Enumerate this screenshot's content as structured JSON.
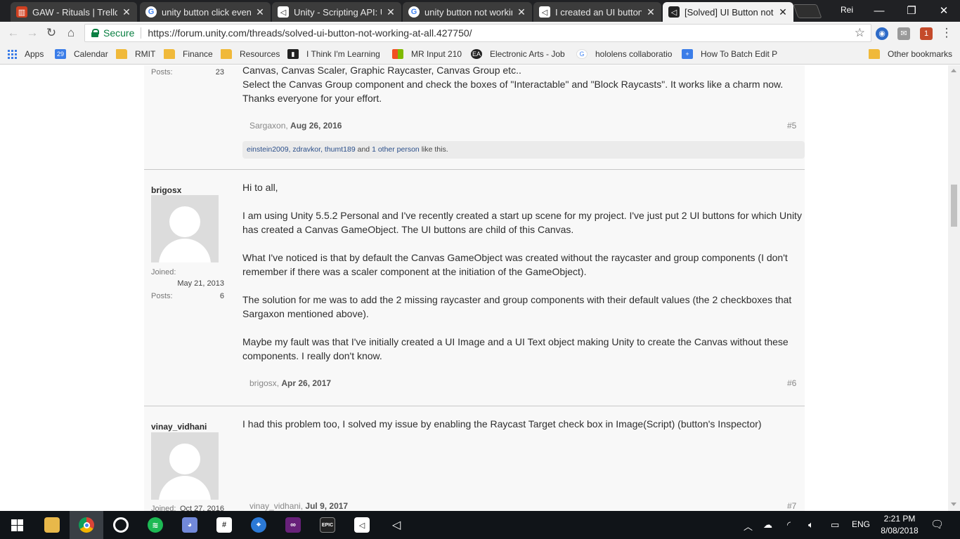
{
  "browser": {
    "tabs": [
      {
        "title": "GAW - Rituals | Trello",
        "icon": "trello-icon"
      },
      {
        "title": "unity button click event",
        "icon": "google-icon"
      },
      {
        "title": "Unity - Scripting API: UI",
        "icon": "unity-icon"
      },
      {
        "title": "unity button not working",
        "icon": "google-icon"
      },
      {
        "title": "I created an UI button b",
        "icon": "unity-icon"
      },
      {
        "title": "[Solved] UI Button not w",
        "icon": "unity-forum-icon"
      }
    ],
    "profile_name": "Rei",
    "secure_label": "Secure",
    "url": "https://forum.unity.com/threads/solved-ui-button-not-working-at-all.427750/",
    "bookmarks": [
      {
        "label": "Apps",
        "icon": "apps-icon"
      },
      {
        "label": "Calendar",
        "icon": "calendar-icon",
        "badge": "29"
      },
      {
        "label": "RMIT",
        "icon": "folder-icon"
      },
      {
        "label": "Finance",
        "icon": "folder-icon"
      },
      {
        "label": "Resources",
        "icon": "folder-icon"
      },
      {
        "label": "I Think I'm Learning",
        "icon": "bookmark-icon"
      },
      {
        "label": "MR Input 210",
        "icon": "microsoft-icon"
      },
      {
        "label": "Electronic Arts - Job",
        "icon": "ea-icon"
      },
      {
        "label": "hololens collaboratio",
        "icon": "google-icon"
      },
      {
        "label": "How To Batch Edit P",
        "icon": "plus-icon"
      },
      {
        "label": "Other bookmarks",
        "icon": "folder-icon"
      }
    ]
  },
  "thread": {
    "post5_tail": {
      "posts_label": "Posts:",
      "posts_value": "23",
      "lines": [
        "Canvas, Canvas Scaler, Graphic Raycaster, Canvas Group etc..",
        "Select the Canvas Group component and check the boxes of \"Interactable\" and \"Block Raycasts\". It works like a charm now.",
        "Thanks everyone for your effort."
      ],
      "author": "Sargaxon",
      "date": "Aug 26, 2016",
      "number": "#5",
      "likes": {
        "users": "einstein2009, zdravkor, thumt189",
        "and": "and",
        "others": "1 other person",
        "suffix": "like this."
      }
    },
    "post6": {
      "username": "brigosx",
      "joined_label": "Joined:",
      "joined_value": "May 21, 2013",
      "posts_label": "Posts:",
      "posts_value": "6",
      "paragraphs": [
        "Hi to all,",
        "I am using Unity 5.5.2 Personal and I've recently created a start up scene for my project. I've just put 2 UI buttons for which Unity has created a Canvas GameObject. The UI buttons are child of this Canvas.",
        "What I've noticed is that by default the Canvas GameObject was created without the raycaster and group components (I don't remember if there was a scaler component at the initiation of the GameObject).",
        "The solution for me was to add the 2 missing raycaster and group components with their default values (the 2 checkboxes that Sargaxon mentioned above).",
        "Maybe my fault was that I've initially created a UI Image and a UI Text object making Unity to create the Canvas without these components. I really don't know."
      ],
      "author": "brigosx",
      "date": "Apr 26, 2017",
      "number": "#6"
    },
    "post7": {
      "username": "vinay_vidhani",
      "joined_label": "Joined:",
      "joined_value": "Oct 27, 2016",
      "text": "I had this problem too, I solved my issue by enabling the Raycast Target check box in Image(Script) (button's Inspector)",
      "author": "vinay_vidhani",
      "date": "Jul 9, 2017",
      "number": "#7"
    }
  },
  "taskbar": {
    "apps": [
      "file-explorer-icon",
      "chrome-icon",
      "groove-icon",
      "spotify-icon",
      "discord-icon",
      "slack-icon",
      "maps-icon",
      "visual-studio-icon",
      "epic-games-icon",
      "unity-icon",
      "unity-hub-icon"
    ],
    "language": "ENG",
    "time": "2:21 PM",
    "date": "8/08/2018"
  },
  "colors": {
    "tabstrip": "#202124",
    "secure_green": "#0b8043",
    "link_blue": "#2b4f8a",
    "taskbar": "#101418"
  }
}
